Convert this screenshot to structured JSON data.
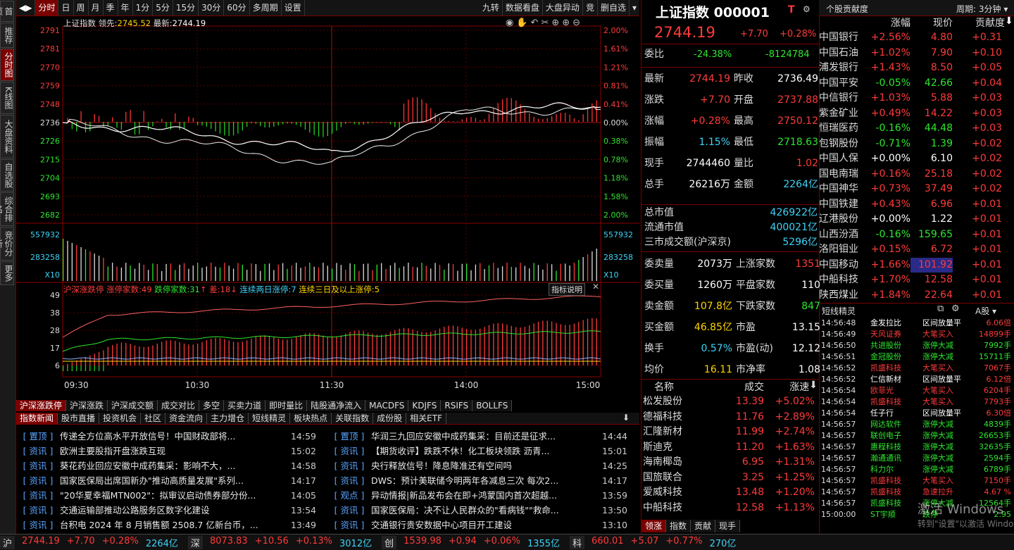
{
  "leftnav": [
    "首页",
    "推荐",
    "分时图",
    "K线图",
    "大盘资料",
    "自选股",
    "综合排名",
    "竞价分析",
    "更多"
  ],
  "toolbar": {
    "left": [
      "分时",
      "日",
      "周",
      "月",
      "季",
      "年",
      "1分",
      "5分",
      "15分",
      "30分",
      "60分",
      "多周期",
      "设置"
    ],
    "right": [
      "九转",
      "数据看盘",
      "大盘异动",
      "竞",
      "删自选"
    ]
  },
  "chart": {
    "header": {
      "name": "上证指数",
      "lead_label": "领先:",
      "lead_val": "2745.52",
      "last_label": "最新:",
      "last_val": "2744.19"
    },
    "price_ticks": [
      "2791",
      "2781",
      "2770",
      "2759",
      "2748",
      "2736",
      "2726",
      "2715",
      "2704",
      "2693",
      "2682"
    ],
    "pct_ticks": [
      "2.00%",
      "1.61%",
      "1.21%",
      "0.81%",
      "0.41%",
      "0.00%",
      "0.38%",
      "0.78%",
      "1.18%",
      "1.58%",
      "2.00%"
    ],
    "vol_ticks": [
      "557932",
      "283258",
      "X10"
    ],
    "limit_header": {
      "title": "沪深涨跌停",
      "up_label": "涨停家数:",
      "up": "49",
      "down_label": "跌停家数:",
      "down": "31",
      "diff_label": "差:",
      "diff": "18",
      "two_label": "连续两日涨停:",
      "two": "7",
      "three_label": "连续三日及以上涨停:",
      "three": "5",
      "help": "指标说明"
    },
    "limit_ticks": [
      "49",
      "38",
      "28",
      "17",
      "6"
    ],
    "time_ticks": [
      "09:30",
      "10:30",
      "11:30",
      "14:00",
      "15:00"
    ]
  },
  "chart_data": {
    "type": "line",
    "title": "上证指数",
    "x": [
      "09:30",
      "10:30",
      "11:30",
      "14:00",
      "15:00"
    ],
    "ylim": [
      2682,
      2791
    ],
    "series": [
      {
        "name": "最新",
        "values": [
          2736.49,
          2724.0,
          2711.0,
          2743.0,
          2744.19
        ]
      },
      {
        "name": "领先",
        "values": [
          2736.49,
          2730.0,
          2719.0,
          2744.0,
          2745.52
        ]
      }
    ]
  },
  "tabs1": [
    "沪深涨跌停",
    "沪深涨跌",
    "沪深成交额",
    "成交对比",
    "多空",
    "买卖力道",
    "即时量比",
    "陆股通净流入",
    "MACDFS",
    "KDJFS",
    "RSIFS",
    "BOLLFS"
  ],
  "tabs2": [
    "指数新闻",
    "股市直播",
    "投资机会",
    "社区",
    "资金流向",
    "主力增仓",
    "短线精灵",
    "板块热点",
    "关联指数",
    "成份股",
    "相关ETF"
  ],
  "news_left": [
    {
      "tag": "置顶",
      "title": "传递全方位高水平开放信号！中国财政部将...",
      "time": "14:59"
    },
    {
      "tag": "资讯",
      "title": "欧洲主要股指开盘涨跌互现",
      "time": "15:02"
    },
    {
      "tag": "资讯",
      "title": "葵花药业回应安徽中成药集采：影响不大，...",
      "time": "14:58"
    },
    {
      "tag": "资讯",
      "title": "国家医保局出席国新办\"推动高质量发展\"系列...",
      "time": "14:17"
    },
    {
      "tag": "资讯",
      "title": "\"20华夏幸福MTN002\"：拟审议启动债券部分份...",
      "time": "14:05"
    },
    {
      "tag": "资讯",
      "title": "交通运输部推动公路服务区数字化建设",
      "time": "13:54"
    },
    {
      "tag": "资讯",
      "title": "台积电 2024 年 8 月销售额 2508.7 亿新台币，...",
      "time": "13:49"
    }
  ],
  "news_right": [
    {
      "tag": "置顶",
      "title": "华润三九回应安徽中成药集采：目前还是征求...",
      "time": "14:44"
    },
    {
      "tag": "资讯",
      "title": "【期货收评】跌跌不休！化工板块领跌 沥青...",
      "time": "15:01"
    },
    {
      "tag": "资讯",
      "title": "央行释放信号！降息降准还有空间吗",
      "time": "14:25"
    },
    {
      "tag": "资讯",
      "title": "DWS：预计美联储今明两年各减息三次 每次2...",
      "time": "14:17"
    },
    {
      "tag": "观点",
      "title": "异动情报|新品发布会在即+鸿蒙国内首次超越...",
      "time": "13:59"
    },
    {
      "tag": "资讯",
      "title": "国家医保局：决不让人民群众的\"看病钱\"\"救命...",
      "time": "13:50"
    },
    {
      "tag": "资讯",
      "title": "交通银行贵安数据中心项目开工建设",
      "time": "13:10"
    }
  ],
  "quote": {
    "name": "上证指数",
    "code": "000001",
    "t": "T",
    "price": "2744.19",
    "chg": "+7.70",
    "pct": "+0.28%",
    "weibi_label": "委比",
    "weibi": "-24.38%",
    "weicha": "-8124784",
    "rows": [
      [
        "最新",
        "2744.19",
        "昨收",
        "2736.49",
        "red",
        "white"
      ],
      [
        "涨跌",
        "+7.70",
        "开盘",
        "2737.88",
        "red",
        "red"
      ],
      [
        "涨幅",
        "+0.28%",
        "最高",
        "2750.12",
        "red",
        "red"
      ],
      [
        "振幅",
        "1.15%",
        "最低",
        "2718.63",
        "cyan",
        "green"
      ],
      [
        "现手",
        "2744460",
        "量比",
        "1.02",
        "white",
        "red"
      ],
      [
        "总手",
        "26216万",
        "金额",
        "2264亿",
        "white",
        "cyan"
      ]
    ],
    "mcap": [
      [
        "总市值",
        "426922亿"
      ],
      [
        "流通市值",
        "400021亿"
      ],
      [
        "三市成交额(沪深京)",
        "5296亿"
      ]
    ],
    "rows2": [
      [
        "委卖量",
        "2073万",
        "上涨家数",
        "1351",
        "white",
        "red"
      ],
      [
        "委买量",
        "1260万",
        "平盘家数",
        "110",
        "white",
        "white"
      ],
      [
        "卖金额",
        "107.8亿",
        "下跌家数",
        "847",
        "yellow",
        "green"
      ],
      [
        "买金额",
        "46.85亿",
        "市盈",
        "13.15",
        "yellow",
        "white"
      ],
      [
        "换手",
        "0.57%",
        "市盈(动)",
        "12.12",
        "cyan",
        "white"
      ],
      [
        "均价",
        "16.11",
        "市净率",
        "1.08",
        "yellow",
        "white"
      ]
    ]
  },
  "speed": {
    "headers": [
      "名称",
      "成交",
      "涨速"
    ],
    "rows": [
      [
        "松发股份",
        "13.39",
        "+5.02%"
      ],
      [
        "德福科技",
        "11.76",
        "+2.89%"
      ],
      [
        "汇隆新材",
        "11.99",
        "+2.74%"
      ],
      [
        "斯迪克",
        "11.20",
        "+1.63%"
      ],
      [
        "海南椰岛",
        "6.95",
        "+1.31%"
      ],
      [
        "国旅联合",
        "3.25",
        "+1.25%"
      ],
      [
        "爱威科技",
        "13.48",
        "+1.20%"
      ],
      [
        "中船科技",
        "12.58",
        "+1.13%"
      ]
    ],
    "tabs": [
      "领涨",
      "指数",
      "贡献",
      "现手"
    ]
  },
  "contrib": {
    "title": "个股贡献度",
    "period": "周期: 3分钟",
    "headers": [
      "",
      "涨幅",
      "现价",
      "贡献度"
    ],
    "rows": [
      [
        "中国银行",
        "+2.56%",
        "4.80",
        "+0.31",
        "red"
      ],
      [
        "中国石油",
        "+1.02%",
        "7.90",
        "+0.10",
        "red"
      ],
      [
        "浦发银行",
        "+1.43%",
        "8.50",
        "+0.05",
        "red"
      ],
      [
        "中国平安",
        "-0.05%",
        "42.66",
        "+0.04",
        "green"
      ],
      [
        "中信银行",
        "+1.03%",
        "5.88",
        "+0.03",
        "red"
      ],
      [
        "紫金矿业",
        "+0.49%",
        "14.22",
        "+0.03",
        "red"
      ],
      [
        "恒瑞医药",
        "-0.16%",
        "44.48",
        "+0.03",
        "green"
      ],
      [
        "包钢股份",
        "-0.71%",
        "1.39",
        "+0.02",
        "green"
      ],
      [
        "中国人保",
        "+0.00%",
        "6.10",
        "+0.02",
        "white"
      ],
      [
        "国电南瑞",
        "+0.16%",
        "25.18",
        "+0.02",
        "red"
      ],
      [
        "中国神华",
        "+0.73%",
        "37.49",
        "+0.02",
        "red"
      ],
      [
        "中国铁建",
        "+0.43%",
        "6.96",
        "+0.01",
        "red"
      ],
      [
        "辽港股份",
        "+0.00%",
        "1.22",
        "+0.01",
        "white"
      ],
      [
        "山西汾酒",
        "-0.16%",
        "159.65",
        "+0.01",
        "green"
      ],
      [
        "洛阳钼业",
        "+0.15%",
        "6.72",
        "+0.01",
        "red"
      ],
      [
        "中国移动",
        "+1.66%",
        "101.92",
        "+0.01",
        "red"
      ],
      [
        "中船科技",
        "+1.70%",
        "12.58",
        "+0.01",
        "red"
      ],
      [
        "陕西煤业",
        "+1.84%",
        "22.64",
        "+0.01",
        "red"
      ]
    ]
  },
  "sprite": {
    "title": "短线精灵",
    "scope": "A股",
    "rows": [
      [
        "14:56:48",
        "金发拉比",
        "区间放量平",
        "6.06倍"
      ],
      [
        "14:56:49",
        "天风证券",
        "大笔买入",
        "14899手"
      ],
      [
        "14:56:50",
        "共进股份",
        "涨停大减",
        "7992手"
      ],
      [
        "14:56:51",
        "金冠股份",
        "涨停大减",
        "15711手"
      ],
      [
        "14:56:52",
        "凯盛科技",
        "大笔买入",
        "7067手"
      ],
      [
        "14:56:52",
        "仁信新材",
        "区间放量平",
        "6.12倍"
      ],
      [
        "14:56:54",
        "欧菲光",
        "大笔买入",
        "6204手"
      ],
      [
        "14:56:54",
        "凯盛科技",
        "大笔买入",
        "7793手"
      ],
      [
        "14:56:54",
        "任子行",
        "区间放量平",
        "6.30倍"
      ],
      [
        "14:56:57",
        "网达软件",
        "涨停大减",
        "4839手"
      ],
      [
        "14:56:57",
        "联创电子",
        "涨停大减",
        "26653手"
      ],
      [
        "14:56:57",
        "惠程科技",
        "涨停大减",
        "32635手"
      ],
      [
        "14:56:57",
        "瀚通通讯",
        "涨停大减",
        "2594手"
      ],
      [
        "14:56:57",
        "科力尔",
        "涨停大减",
        "6789手"
      ],
      [
        "14:56:57",
        "凯盛科技",
        "大笔买入",
        "7150手"
      ],
      [
        "14:56:57",
        "凯盛科技",
        "急速拉升",
        "4.67 %"
      ],
      [
        "14:56:57",
        "凯盛科技",
        "涨停大减",
        "12564手"
      ],
      [
        "15:00:00",
        "ST宇顺",
        "跌停",
        "2.95"
      ]
    ]
  },
  "watermark": [
    "激活 Windows",
    "转到\"设置\"以激活 Windows。"
  ],
  "status": [
    {
      "k": "沪",
      "v": "2744.19",
      "c": "+7.70",
      "p": "+0.28%",
      "a": "2264亿"
    },
    {
      "k": "深",
      "v": "8073.83",
      "c": "+10.56",
      "p": "+0.13%",
      "a": "3012亿"
    },
    {
      "k": "创",
      "v": "1539.98",
      "c": "+0.94",
      "p": "+0.06%",
      "a": "1355亿"
    },
    {
      "k": "科",
      "v": "660.01",
      "c": "+5.07",
      "p": "+0.77%",
      "a": "270亿"
    }
  ]
}
